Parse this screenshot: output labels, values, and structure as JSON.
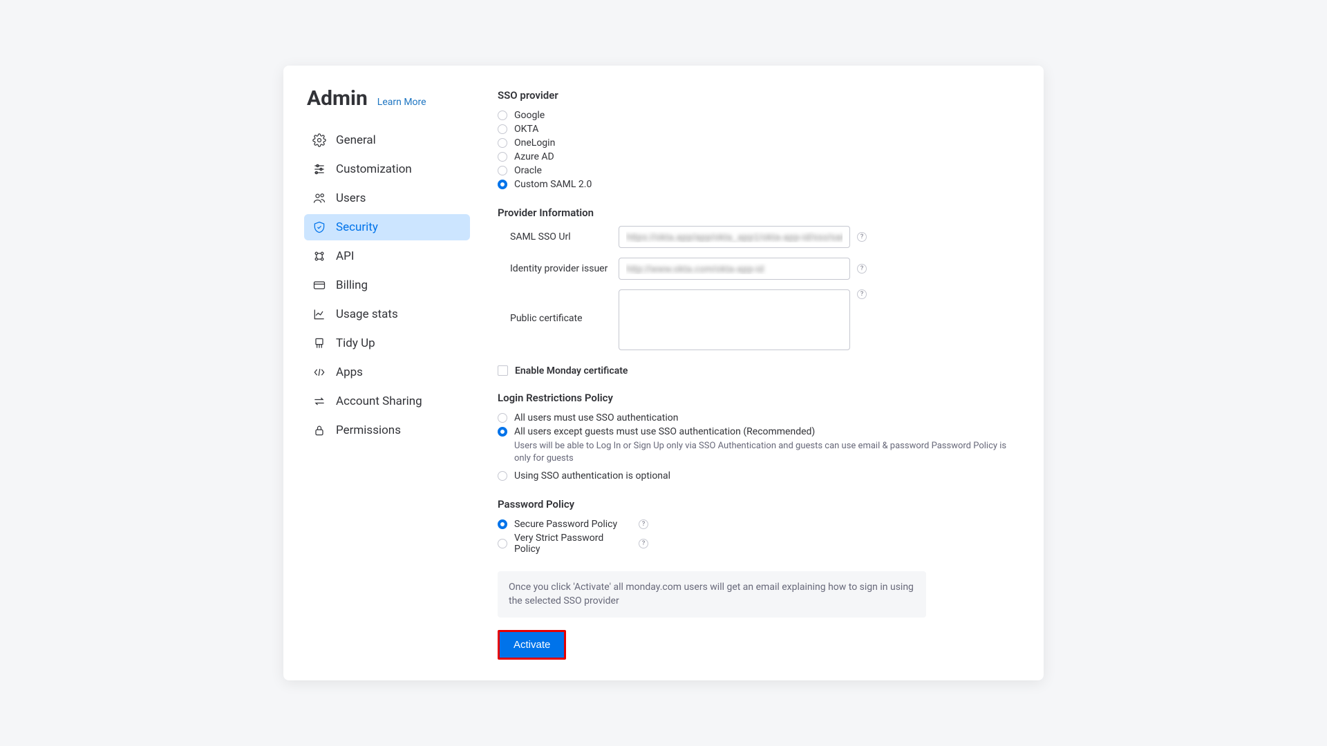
{
  "header": {
    "title": "Admin",
    "learn_more": "Learn More"
  },
  "sidebar": {
    "items": [
      {
        "label": "General"
      },
      {
        "label": "Customization"
      },
      {
        "label": "Users"
      },
      {
        "label": "Security"
      },
      {
        "label": "API"
      },
      {
        "label": "Billing"
      },
      {
        "label": "Usage stats"
      },
      {
        "label": "Tidy Up"
      },
      {
        "label": "Apps"
      },
      {
        "label": "Account Sharing"
      },
      {
        "label": "Permissions"
      }
    ]
  },
  "sso": {
    "section_title": "SSO provider",
    "options": [
      "Google",
      "OKTA",
      "OneLogin",
      "Azure AD",
      "Oracle",
      "Custom SAML 2.0"
    ]
  },
  "provider_info": {
    "section_title": "Provider Information",
    "saml_label": "SAML SSO Url",
    "saml_value": "https://okta.app/app/okta_app1/okta-app-id/sso/saml",
    "idp_label": "Identity provider issuer",
    "idp_value": "http://www.okta.com/okta-app-id",
    "cert_label": "Public certificate",
    "enable_cert": "Enable Monday certificate"
  },
  "login_policy": {
    "section_title": "Login Restrictions Policy",
    "opt1": "All users must use SSO authentication",
    "opt2": "All users except guests must use SSO authentication (Recommended)",
    "opt2_desc": "Users will be able to Log In or Sign Up only via SSO Authentication and guests can use email & password Password Policy is only for guests",
    "opt3": "Using SSO authentication is optional"
  },
  "password_policy": {
    "section_title": "Password Policy",
    "opt1": "Secure Password Policy",
    "opt2": "Very Strict Password Policy"
  },
  "info_text": "Once you click 'Activate' all monday.com users will get an email explaining how to sign in using the selected SSO provider",
  "activate_label": "Activate"
}
